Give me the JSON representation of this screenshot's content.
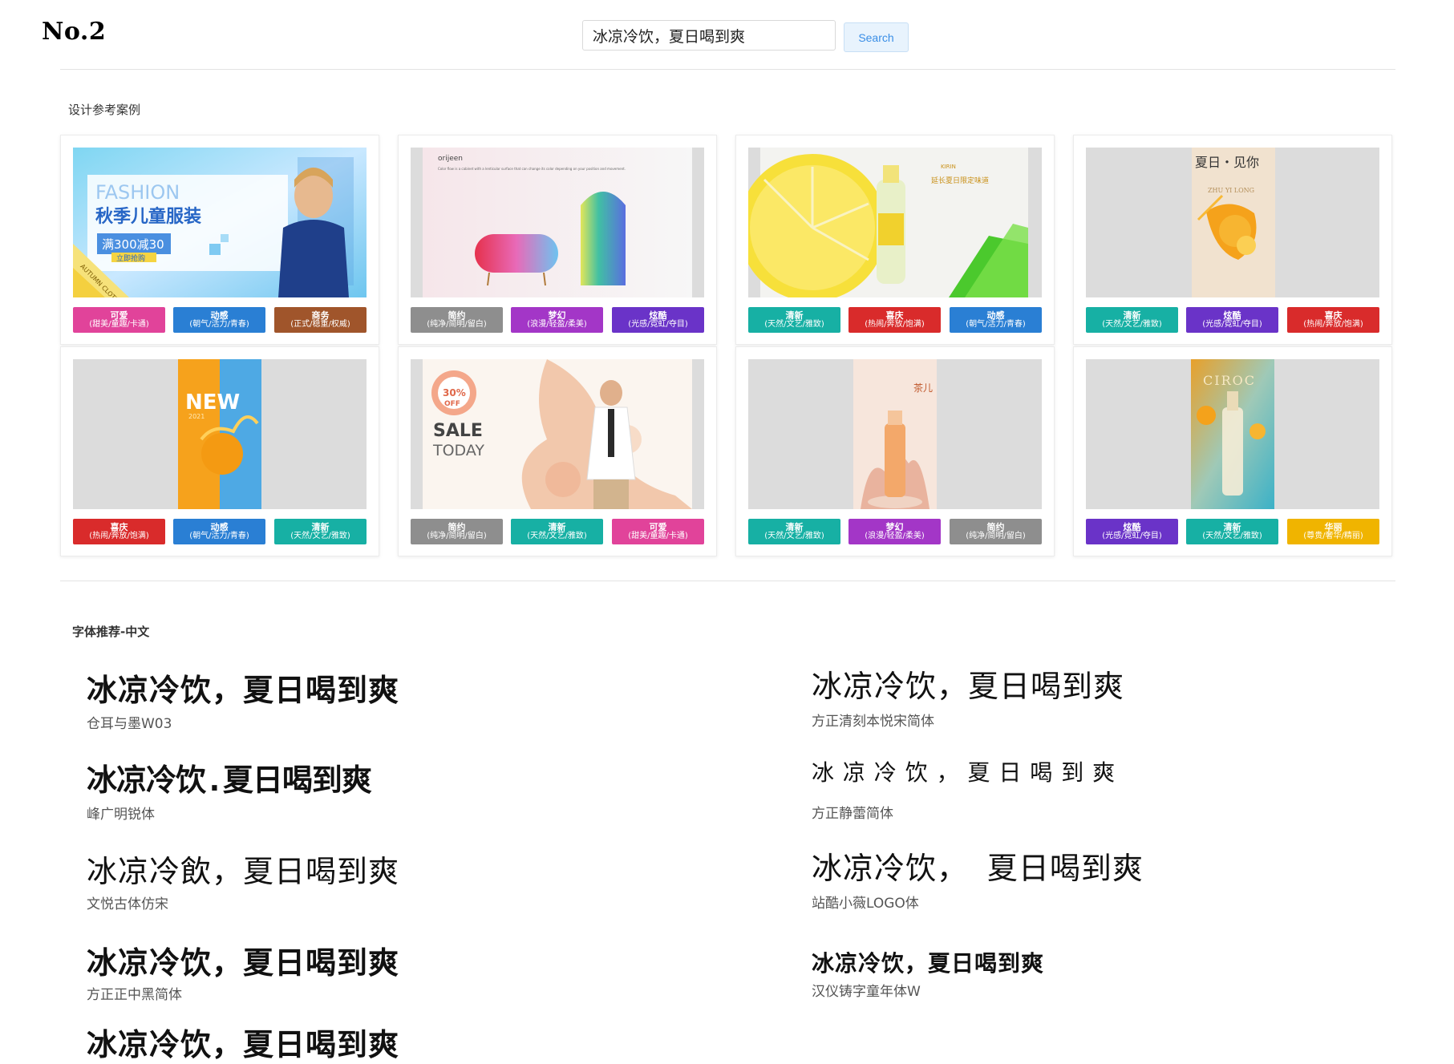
{
  "header": {
    "brand": "No.2",
    "search_value": "冰凉冷饮，夏日喝到爽",
    "search_button": "Search"
  },
  "cases": {
    "title": "设计参考案例",
    "items": [
      {
        "tags": [
          {
            "name": "可爱",
            "desc": "(甜美/童趣/卡通)",
            "color": "#e1439a"
          },
          {
            "name": "动感",
            "desc": "(朝气/活力/青春)",
            "color": "#2a7fd4"
          },
          {
            "name": "商务",
            "desc": "(正式/稳重/权威)",
            "color": "#a0552b"
          }
        ]
      },
      {
        "tags": [
          {
            "name": "简约",
            "desc": "(纯净/简明/留白)",
            "color": "#8e8e8e"
          },
          {
            "name": "梦幻",
            "desc": "(浪漫/轻盈/柔美)",
            "color": "#a336c7"
          },
          {
            "name": "炫酷",
            "desc": "(光感/霓虹/夺目)",
            "color": "#6a33c8"
          }
        ]
      },
      {
        "tags": [
          {
            "name": "清新",
            "desc": "(天然/文艺/雅致)",
            "color": "#17b0a4"
          },
          {
            "name": "喜庆",
            "desc": "(热闹/奔放/饱满)",
            "color": "#d92b2b"
          },
          {
            "name": "动感",
            "desc": "(朝气/活力/青春)",
            "color": "#2a7fd4"
          }
        ]
      },
      {
        "tags": [
          {
            "name": "清新",
            "desc": "(天然/文艺/雅致)",
            "color": "#17b0a4"
          },
          {
            "name": "炫酷",
            "desc": "(光感/霓虹/夺目)",
            "color": "#6a33c8"
          },
          {
            "name": "喜庆",
            "desc": "(热闹/奔放/饱满)",
            "color": "#d92b2b"
          }
        ]
      },
      {
        "tags": [
          {
            "name": "喜庆",
            "desc": "(热闹/奔放/饱满)",
            "color": "#d92b2b"
          },
          {
            "name": "动感",
            "desc": "(朝气/活力/青春)",
            "color": "#2a7fd4"
          },
          {
            "name": "清新",
            "desc": "(天然/文艺/雅致)",
            "color": "#17b0a4"
          }
        ]
      },
      {
        "tags": [
          {
            "name": "简约",
            "desc": "(纯净/简明/留白)",
            "color": "#8e8e8e"
          },
          {
            "name": "清新",
            "desc": "(天然/文艺/雅致)",
            "color": "#17b0a4"
          },
          {
            "name": "可爱",
            "desc": "(甜美/童趣/卡通)",
            "color": "#e1439a"
          }
        ]
      },
      {
        "tags": [
          {
            "name": "清新",
            "desc": "(天然/文艺/雅致)",
            "color": "#17b0a4"
          },
          {
            "name": "梦幻",
            "desc": "(浪漫/轻盈/柔美)",
            "color": "#a336c7"
          },
          {
            "name": "简约",
            "desc": "(纯净/简明/留白)",
            "color": "#8e8e8e"
          }
        ]
      },
      {
        "tags": [
          {
            "name": "炫酷",
            "desc": "(光感/霓虹/夺目)",
            "color": "#6a33c8"
          },
          {
            "name": "清新",
            "desc": "(天然/文艺/雅致)",
            "color": "#17b0a4"
          },
          {
            "name": "华丽",
            "desc": "(尊贵/奢华/精丽)",
            "color": "#f0b400"
          }
        ]
      }
    ]
  },
  "thumb_text": {
    "c1_title": "FASHION",
    "c1_sub": "秋季儿童服装",
    "c1_offer": "满300减30",
    "c1_btn": "立即抢购",
    "c1_ribbon": "AUTUMN CLOTHES",
    "c2_brand": "orijeen",
    "c2_desc": "Color flow is a cabinet with a lenticular surface that can change its color depending on your position and movement.",
    "c3_brand": "KIRIN",
    "c3_title": "延长夏日限定味道",
    "c4_title": "夏日・见你",
    "c4_sub": "ZHU YI LONG",
    "c5_big": "NEW",
    "c5_year": "2021",
    "c6_badge1": "30%",
    "c6_badge2": "OFF",
    "c6_sale": "SALE",
    "c6_today": "TODAY",
    "c7_text": "茶儿",
    "c8_brand": "CIROC"
  },
  "fonts": {
    "title": "字体推荐-中文",
    "items": [
      {
        "sample": "冰凉冷饮，夏日喝到爽",
        "name": "仓耳与墨W03"
      },
      {
        "sample": "冰凉冷饮，夏日喝到爽",
        "name": "方正清刻本悦宋简体"
      },
      {
        "sample": "冰凉冷饮.夏日喝到爽",
        "name": "峰广明锐体"
      },
      {
        "sample": "冰 凉 冷 饮 ，  夏 日 喝 到 爽",
        "name": "方正静蕾简体"
      },
      {
        "sample": "冰凉冷飲，夏日喝到爽",
        "name": "文悦古体仿宋"
      },
      {
        "sample": "冰凉冷饮，  夏日喝到爽",
        "name": "站酷小薇LOGO体"
      },
      {
        "sample": "冰凉冷饮，夏日喝到爽",
        "name": "方正正中黑简体"
      },
      {
        "sample": "冰凉冷饮，夏日喝到爽",
        "name": "汉仪铸字童年体W"
      },
      {
        "sample": "冰凉冷饮，夏日喝到爽",
        "name": ""
      }
    ]
  }
}
